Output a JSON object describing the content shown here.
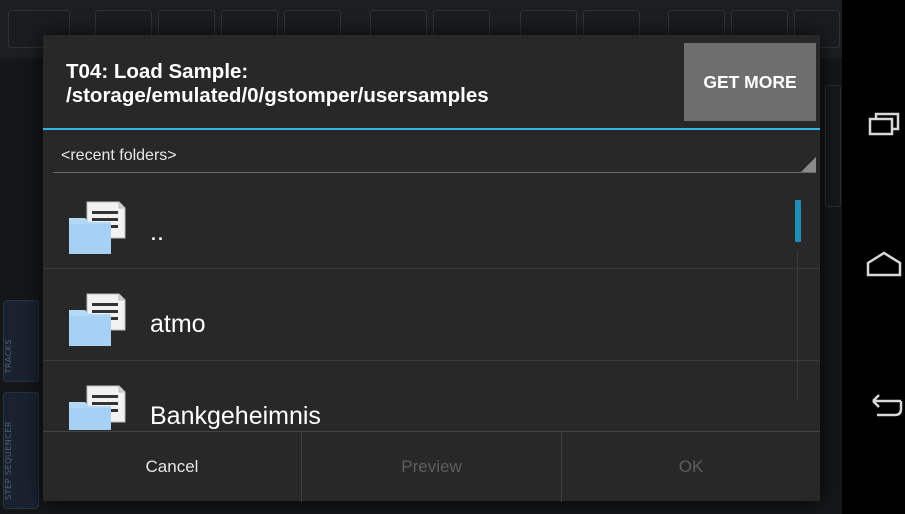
{
  "dialog": {
    "title_line1": "T04: Load Sample:",
    "title_line2": "/storage/emulated/0/gstomper/usersamples",
    "get_more_label": "GET MORE",
    "folder_select_value": "<recent folders>",
    "files": [
      {
        "name": "..",
        "icon": "folder-document-icon"
      },
      {
        "name": "atmo",
        "icon": "folder-document-icon"
      },
      {
        "name": "Bankgeheimnis",
        "icon": "folder-document-icon"
      }
    ],
    "buttons": {
      "cancel": "Cancel",
      "preview": "Preview",
      "ok": "OK"
    }
  },
  "background_app": {
    "side_tabs": [
      "TRACKS",
      "STEP SEQUENCER"
    ]
  },
  "navbar": {
    "icons": [
      "recent-apps-icon",
      "home-icon",
      "back-icon"
    ]
  },
  "colors": {
    "accent": "#33b5e5",
    "dialog_bg": "#282828",
    "get_more_bg": "#6e6e6e",
    "folder_icon": "#b3d9f7",
    "disabled_text": "#5e5e5e"
  }
}
